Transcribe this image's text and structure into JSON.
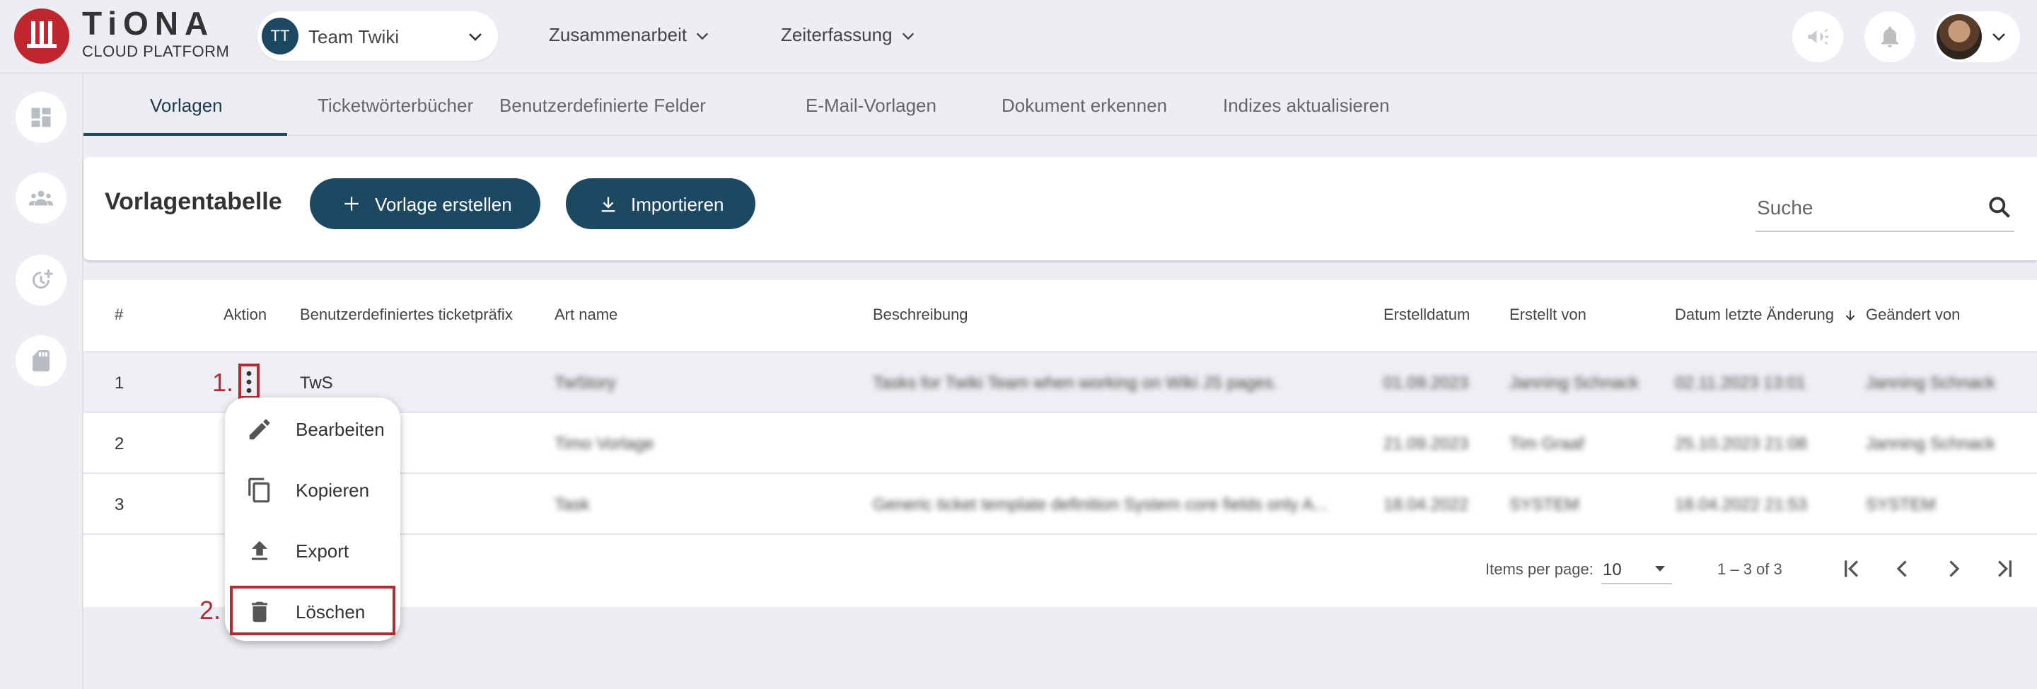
{
  "brand": {
    "title": "TiONA",
    "subtitle": "CLOUD PLATFORM"
  },
  "team": {
    "initials": "TT",
    "name": "Team Twiki"
  },
  "nav": {
    "collaboration": "Zusammenarbeit",
    "time_tracking": "Zeiterfassung"
  },
  "tabs": [
    {
      "label": "Vorlagen",
      "active": true
    },
    {
      "label": "Ticketwörterbücher"
    },
    {
      "label": "Benutzerdefinierte Felder"
    },
    {
      "label": "E-Mail-Vorlagen"
    },
    {
      "label": "Dokument erkennen"
    },
    {
      "label": "Indizes aktualisieren"
    }
  ],
  "card": {
    "title": "Vorlagentabelle",
    "create_label": "Vorlage erstellen",
    "import_label": "Importieren",
    "search_placeholder": "Suche"
  },
  "table": {
    "headers": [
      "#",
      "Aktion",
      "Benutzerdefiniertes ticketpräfix",
      "Art name",
      "Beschreibung",
      "Erstelldatum",
      "Erstellt von",
      "Datum letzte Änderung",
      "Geändert von"
    ],
    "rows": [
      {
        "num": "1",
        "prefix": "TwS",
        "name": "TwStory",
        "description": "Tasks for Twiki Team when working on Wiki JS pages.",
        "created": "01.09.2023",
        "created_by": "Janning Schnack",
        "modified": "02.11.2023 13:01",
        "modified_by": "Janning Schnack"
      },
      {
        "num": "2",
        "prefix": "",
        "name": "Timo Vorlage",
        "description": "",
        "created": "21.09.2023",
        "created_by": "Tim Graaf",
        "modified": "25.10.2023 21:08",
        "modified_by": "Janning Schnack"
      },
      {
        "num": "3",
        "prefix": "",
        "name": "Task",
        "description": "Generic ticket template definition System core fields only A...",
        "created": "18.04.2022",
        "created_by": "SYSTEM",
        "modified": "18.04.2022 21:53",
        "modified_by": "SYSTEM"
      }
    ],
    "items_per_page_label": "Items per page:",
    "items_per_page": "10",
    "range": "1 – 3 of 3"
  },
  "menu": {
    "edit": "Bearbeiten",
    "copy": "Kopieren",
    "export": "Export",
    "delete": "Löschen"
  },
  "steps": {
    "one": "1.",
    "two": "2."
  },
  "colors": {
    "brand_red": "#c0262d",
    "primary": "#1d4861",
    "highlight": "#b22a32",
    "background": "#edeef3"
  }
}
